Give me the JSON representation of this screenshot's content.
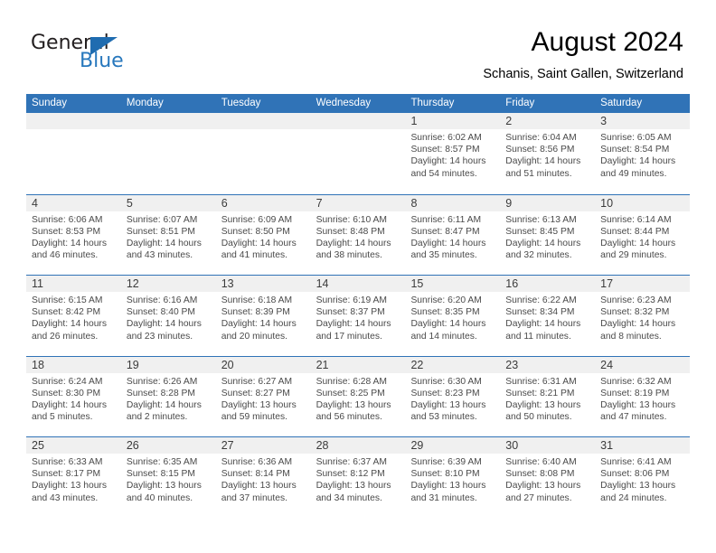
{
  "brand": {
    "name_part1": "General",
    "name_part2": "Blue",
    "triangle_color": "#1f6cb0",
    "blue_text_color": "#2878bd"
  },
  "header": {
    "title": "August 2024",
    "subtitle": "Schanis, Saint Gallen, Switzerland"
  },
  "colors": {
    "header_blue": "#3073b7",
    "day_band_gray": "#f0f0f0",
    "text_gray": "#4a4a4a"
  },
  "weekday_headers": [
    "Sunday",
    "Monday",
    "Tuesday",
    "Wednesday",
    "Thursday",
    "Friday",
    "Saturday"
  ],
  "weeks": [
    [
      {
        "day": "",
        "lines": []
      },
      {
        "day": "",
        "lines": []
      },
      {
        "day": "",
        "lines": []
      },
      {
        "day": "",
        "lines": []
      },
      {
        "day": "1",
        "lines": [
          "Sunrise: 6:02 AM",
          "Sunset: 8:57 PM",
          "Daylight: 14 hours",
          "and 54 minutes."
        ]
      },
      {
        "day": "2",
        "lines": [
          "Sunrise: 6:04 AM",
          "Sunset: 8:56 PM",
          "Daylight: 14 hours",
          "and 51 minutes."
        ]
      },
      {
        "day": "3",
        "lines": [
          "Sunrise: 6:05 AM",
          "Sunset: 8:54 PM",
          "Daylight: 14 hours",
          "and 49 minutes."
        ]
      }
    ],
    [
      {
        "day": "4",
        "lines": [
          "Sunrise: 6:06 AM",
          "Sunset: 8:53 PM",
          "Daylight: 14 hours",
          "and 46 minutes."
        ]
      },
      {
        "day": "5",
        "lines": [
          "Sunrise: 6:07 AM",
          "Sunset: 8:51 PM",
          "Daylight: 14 hours",
          "and 43 minutes."
        ]
      },
      {
        "day": "6",
        "lines": [
          "Sunrise: 6:09 AM",
          "Sunset: 8:50 PM",
          "Daylight: 14 hours",
          "and 41 minutes."
        ]
      },
      {
        "day": "7",
        "lines": [
          "Sunrise: 6:10 AM",
          "Sunset: 8:48 PM",
          "Daylight: 14 hours",
          "and 38 minutes."
        ]
      },
      {
        "day": "8",
        "lines": [
          "Sunrise: 6:11 AM",
          "Sunset: 8:47 PM",
          "Daylight: 14 hours",
          "and 35 minutes."
        ]
      },
      {
        "day": "9",
        "lines": [
          "Sunrise: 6:13 AM",
          "Sunset: 8:45 PM",
          "Daylight: 14 hours",
          "and 32 minutes."
        ]
      },
      {
        "day": "10",
        "lines": [
          "Sunrise: 6:14 AM",
          "Sunset: 8:44 PM",
          "Daylight: 14 hours",
          "and 29 minutes."
        ]
      }
    ],
    [
      {
        "day": "11",
        "lines": [
          "Sunrise: 6:15 AM",
          "Sunset: 8:42 PM",
          "Daylight: 14 hours",
          "and 26 minutes."
        ]
      },
      {
        "day": "12",
        "lines": [
          "Sunrise: 6:16 AM",
          "Sunset: 8:40 PM",
          "Daylight: 14 hours",
          "and 23 minutes."
        ]
      },
      {
        "day": "13",
        "lines": [
          "Sunrise: 6:18 AM",
          "Sunset: 8:39 PM",
          "Daylight: 14 hours",
          "and 20 minutes."
        ]
      },
      {
        "day": "14",
        "lines": [
          "Sunrise: 6:19 AM",
          "Sunset: 8:37 PM",
          "Daylight: 14 hours",
          "and 17 minutes."
        ]
      },
      {
        "day": "15",
        "lines": [
          "Sunrise: 6:20 AM",
          "Sunset: 8:35 PM",
          "Daylight: 14 hours",
          "and 14 minutes."
        ]
      },
      {
        "day": "16",
        "lines": [
          "Sunrise: 6:22 AM",
          "Sunset: 8:34 PM",
          "Daylight: 14 hours",
          "and 11 minutes."
        ]
      },
      {
        "day": "17",
        "lines": [
          "Sunrise: 6:23 AM",
          "Sunset: 8:32 PM",
          "Daylight: 14 hours",
          "and 8 minutes."
        ]
      }
    ],
    [
      {
        "day": "18",
        "lines": [
          "Sunrise: 6:24 AM",
          "Sunset: 8:30 PM",
          "Daylight: 14 hours",
          "and 5 minutes."
        ]
      },
      {
        "day": "19",
        "lines": [
          "Sunrise: 6:26 AM",
          "Sunset: 8:28 PM",
          "Daylight: 14 hours",
          "and 2 minutes."
        ]
      },
      {
        "day": "20",
        "lines": [
          "Sunrise: 6:27 AM",
          "Sunset: 8:27 PM",
          "Daylight: 13 hours",
          "and 59 minutes."
        ]
      },
      {
        "day": "21",
        "lines": [
          "Sunrise: 6:28 AM",
          "Sunset: 8:25 PM",
          "Daylight: 13 hours",
          "and 56 minutes."
        ]
      },
      {
        "day": "22",
        "lines": [
          "Sunrise: 6:30 AM",
          "Sunset: 8:23 PM",
          "Daylight: 13 hours",
          "and 53 minutes."
        ]
      },
      {
        "day": "23",
        "lines": [
          "Sunrise: 6:31 AM",
          "Sunset: 8:21 PM",
          "Daylight: 13 hours",
          "and 50 minutes."
        ]
      },
      {
        "day": "24",
        "lines": [
          "Sunrise: 6:32 AM",
          "Sunset: 8:19 PM",
          "Daylight: 13 hours",
          "and 47 minutes."
        ]
      }
    ],
    [
      {
        "day": "25",
        "lines": [
          "Sunrise: 6:33 AM",
          "Sunset: 8:17 PM",
          "Daylight: 13 hours",
          "and 43 minutes."
        ]
      },
      {
        "day": "26",
        "lines": [
          "Sunrise: 6:35 AM",
          "Sunset: 8:15 PM",
          "Daylight: 13 hours",
          "and 40 minutes."
        ]
      },
      {
        "day": "27",
        "lines": [
          "Sunrise: 6:36 AM",
          "Sunset: 8:14 PM",
          "Daylight: 13 hours",
          "and 37 minutes."
        ]
      },
      {
        "day": "28",
        "lines": [
          "Sunrise: 6:37 AM",
          "Sunset: 8:12 PM",
          "Daylight: 13 hours",
          "and 34 minutes."
        ]
      },
      {
        "day": "29",
        "lines": [
          "Sunrise: 6:39 AM",
          "Sunset: 8:10 PM",
          "Daylight: 13 hours",
          "and 31 minutes."
        ]
      },
      {
        "day": "30",
        "lines": [
          "Sunrise: 6:40 AM",
          "Sunset: 8:08 PM",
          "Daylight: 13 hours",
          "and 27 minutes."
        ]
      },
      {
        "day": "31",
        "lines": [
          "Sunrise: 6:41 AM",
          "Sunset: 8:06 PM",
          "Daylight: 13 hours",
          "and 24 minutes."
        ]
      }
    ]
  ]
}
